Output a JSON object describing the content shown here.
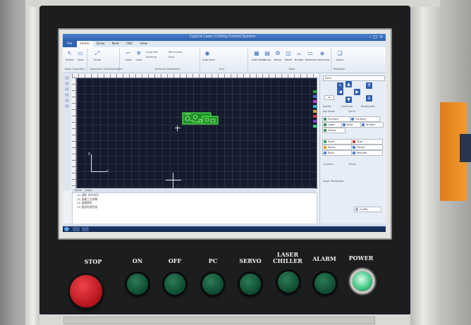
{
  "app": {
    "window_title": "CypCut Laser Cutting Control System",
    "window_buttons": [
      "–",
      "□",
      "×"
    ]
  },
  "ribbon": {
    "tabs": [
      "Home",
      "Draw",
      "Nest",
      "CNC",
      "View"
    ],
    "file_tab": "File",
    "active_tab": "Home",
    "buttons": [
      "Select",
      "View",
      "Scale",
      "Lead",
      "Cool",
      "Auto Sort",
      "Auto Nest",
      "Array",
      "Setup",
      "Mode",
      "Bridge",
      "Measure",
      "Optimize",
      "Layer"
    ],
    "groups": [
      "Basic Operation",
      "Geometric Transformation",
      "Technical Parameter",
      "Sort",
      "Tools",
      "Ploisition"
    ],
    "checks": [
      "Lead Pos",
      "Micro Joint",
      "Reverse",
      "Seal"
    ]
  },
  "canvas": {
    "axis_x": "x",
    "axis_y": "y"
  },
  "log": {
    "tabs": [
      "Draw",
      "Layer"
    ],
    "lines": [
      "(1) 读取 文件成功",
      "(2) 加载工艺参数",
      "(3) 加载图形",
      "(4) 图形处理完成"
    ]
  },
  "control": {
    "selector": "Point",
    "buttons": [
      {
        "label": "Go Back",
        "color": "#3c8f5c"
      },
      {
        "label": "Go Mark",
        "color": "#4a7bd0"
      },
      {
        "label": "Laser",
        "color": "#2d8a5a"
      },
      {
        "label": "Blow",
        "color": "#4a7bd0"
      },
      {
        "label": "Follow",
        "color": "#3c8f5c"
      },
      {
        "label": "Shutter",
        "color": "#4a7bd0"
      },
      {
        "label": "Start",
        "color": "#2aa05a"
      },
      {
        "label": "Stop",
        "color": "#d03a3a"
      },
      {
        "label": "Pause",
        "color": "#d89a1c"
      },
      {
        "label": "Frame",
        "color": "#4a7bd0"
      },
      {
        "label": "Back",
        "color": "#4a7bd0"
      },
      {
        "label": "Resume",
        "color": "#4a7bd0"
      }
    ],
    "texts": [
      "Speed",
      "Continue",
      "Breakpoint",
      "Jog mode",
      "Go to",
      "Counter",
      "Times"
    ],
    "log_select": "Laser Parameter",
    "complete_btn": "Config"
  },
  "hardware_buttons": [
    {
      "label": "STOP",
      "type": "stop"
    },
    {
      "label": "ON",
      "type": "green"
    },
    {
      "label": "OFF",
      "type": "green"
    },
    {
      "label": "PC",
      "type": "green"
    },
    {
      "label": "SERVO",
      "type": "green"
    },
    {
      "label": "LASER CHILLER",
      "type": "green"
    },
    {
      "label": "ALARM",
      "type": "green"
    },
    {
      "label": "POWER",
      "type": "power"
    }
  ]
}
